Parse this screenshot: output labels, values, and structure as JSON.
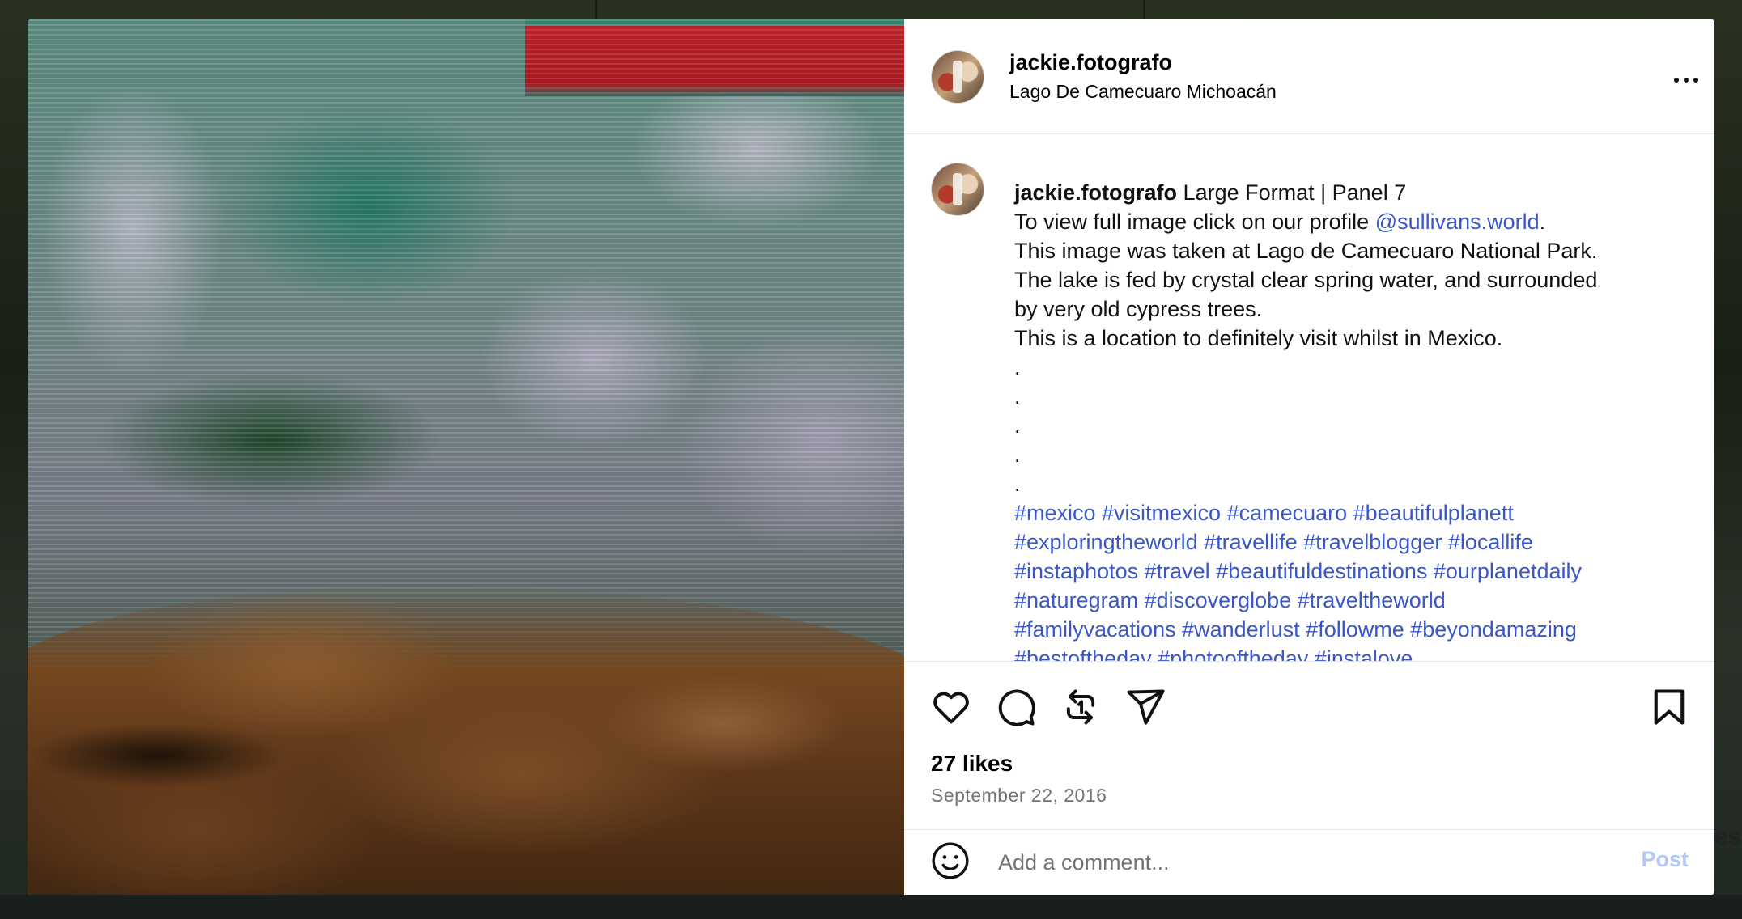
{
  "post": {
    "username": "jackie.fotografo",
    "location": "Lago De Camecuaro Michoacán"
  },
  "caption": {
    "username": "jackie.fotografo",
    "title_rest": " Large Format | Panel 7",
    "line2_prefix": "To view full image click on our profile ",
    "mention": "@sullivans.world",
    "line2_suffix": ".",
    "line3": "This image was taken at Lago de Camecuaro National Park.",
    "line4": "The lake is fed by crystal clear spring water, and surrounded",
    "line5": "by very old cypress trees.",
    "line6": "This is a location to definitely visit whilst in Mexico.",
    "dots": [
      ".",
      ".",
      ".",
      ".",
      "."
    ],
    "hashtag_lines": [
      "#mexico #visitmexico #camecuaro #beautifulplanett",
      "#exploringtheworld #travellife #travelblogger #locallife",
      "#instaphotos #travel #beautifuldestinations #ourplanetdaily",
      "#naturegram #discoverglobe #traveltheworld",
      "#familyvacations #wanderlust #followme #beyondamazing",
      "#bestoftheday #photooftheday #instalove"
    ]
  },
  "stats": {
    "likes": "27 likes",
    "date": "September 22, 2016"
  },
  "comment": {
    "placeholder": "Add a comment...",
    "post_label": "Post"
  },
  "background": {
    "partial_text": "es"
  },
  "colors": {
    "link": "#3a56c9",
    "post_button": "#b3c8f7"
  }
}
